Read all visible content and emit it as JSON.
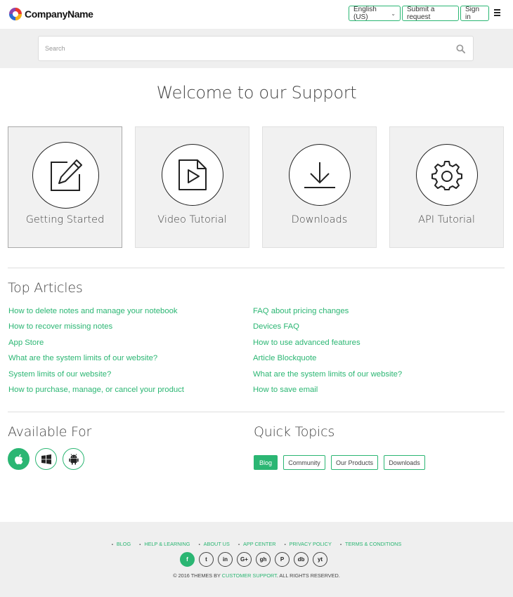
{
  "header": {
    "brand": "CompanyName",
    "language": "English (US)",
    "submit_label": "Submit a request",
    "signin_label": "Sign in"
  },
  "search": {
    "placeholder": "Search"
  },
  "welcome": "Welcome to our Support",
  "cards": [
    {
      "label": "Getting Started",
      "icon": "edit-icon"
    },
    {
      "label": "Video Tutorial",
      "icon": "video-file-icon"
    },
    {
      "label": "Downloads",
      "icon": "download-icon"
    },
    {
      "label": "API Tutorial",
      "icon": "gear-icon"
    }
  ],
  "top_articles": {
    "title": "Top Articles",
    "left": [
      "How to delete notes and manage your notebook",
      "How to recover missing notes",
      "App Store",
      "What are the system limits of our website?",
      "System limits of our website?",
      "How to purchase, manage, or cancel your product"
    ],
    "right": [
      "FAQ about pricing changes",
      "Devices FAQ",
      "How to use advanced features",
      "Article Blockquote",
      "What are the system limits of our website?",
      "How to save email"
    ]
  },
  "available_for": {
    "title": "Available For",
    "platforms": [
      "apple-icon",
      "windows-icon",
      "android-icon"
    ]
  },
  "quick_topics": {
    "title": "Quick Topics",
    "tags": [
      "Blog",
      "Community",
      "Our Products",
      "Downloads"
    ]
  },
  "footer": {
    "links": [
      "BLOG",
      "HELP & LEARNING",
      "ABOUT US",
      "APP CENTER",
      "PRIVACY POLICY",
      "TERMS & CONDITIONS"
    ],
    "socials": [
      {
        "icon": "facebook-icon",
        "glyph": "f"
      },
      {
        "icon": "twitter-icon",
        "glyph": "t"
      },
      {
        "icon": "linkedin-icon",
        "glyph": "in"
      },
      {
        "icon": "google-plus-icon",
        "glyph": "G+"
      },
      {
        "icon": "github-icon",
        "glyph": "gh"
      },
      {
        "icon": "pinterest-icon",
        "glyph": "P"
      },
      {
        "icon": "dropbox-icon",
        "glyph": "db"
      },
      {
        "icon": "youtube-icon",
        "glyph": "yt"
      }
    ],
    "copyright_prefix": "© 2016 THEMES BY",
    "copyright_link": "CUSTOMER SUPPORT",
    "copyright_suffix": ". ALL RIGHTS RESERVED."
  },
  "colors": {
    "accent": "#2bb673",
    "band": "#efefef",
    "card": "#f1f1f1",
    "text": "#444444"
  }
}
